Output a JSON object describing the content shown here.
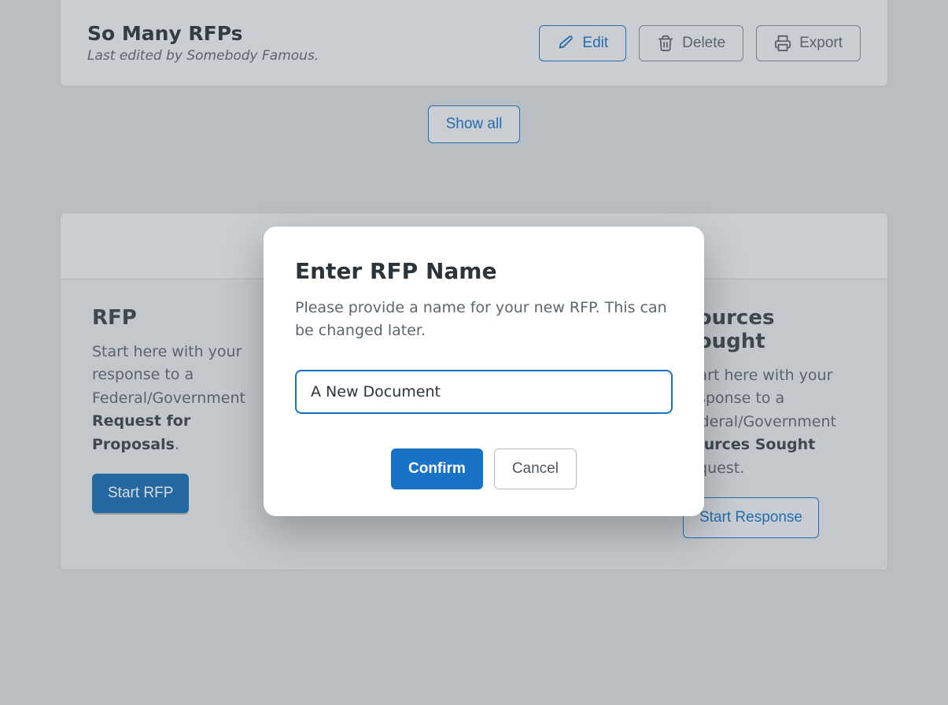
{
  "card": {
    "title": "So Many RFPs",
    "subtitle": "Last edited by Somebody Famous.",
    "edit_label": "Edit",
    "delete_label": "Delete",
    "export_label": "Export"
  },
  "show_all_label": "Show all",
  "left_col": {
    "title": "RFP",
    "text_pre": "Start here with your response to a Federal/Government ",
    "text_bold": "Request for Proposals",
    "text_post": ".",
    "button": "Start RFP"
  },
  "right_col": {
    "title": "Sources Sought",
    "text_pre": "Start here with your response to a Federal/Government ",
    "text_bold": "Sources Sought",
    "text_post": " request.",
    "button": "Start Response"
  },
  "modal": {
    "title": "Enter RFP Name",
    "text": "Please provide a name for your new RFP. This can be changed later.",
    "input_value": "A New Document",
    "confirm": "Confirm",
    "cancel": "Cancel"
  }
}
